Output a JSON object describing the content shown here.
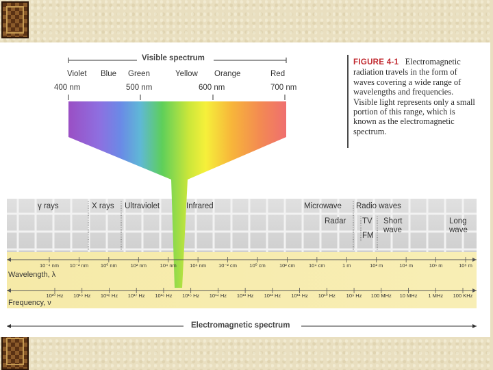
{
  "visible_spectrum": {
    "title": "Visible spectrum",
    "colors": [
      "Violet",
      "Blue",
      "Green",
      "Yellow",
      "Orange",
      "Red"
    ],
    "wavelengths": [
      "400 nm",
      "500 nm",
      "600 nm",
      "700 nm"
    ]
  },
  "caption": {
    "figure_label": "FIGURE 4-1",
    "text": "Electromagnetic radiation travels in the form of waves covering a wide range of wavelengths and frequencies. Visible light represents only a small portion of this range, which is known as the electromagnetic spectrum."
  },
  "regions": [
    "γ rays",
    "X rays",
    "Ultraviolet",
    "Infrared",
    "Microwave",
    "Radio waves"
  ],
  "subregions": [
    "Radar",
    "TV",
    "FM",
    "Short wave",
    "Long wave"
  ],
  "wavelength_axis": {
    "label": "Wavelength, λ",
    "ticks": [
      "10⁻⁴ nm",
      "10⁻² nm",
      "10⁰ nm",
      "10² nm",
      "10⁴ nm",
      "10⁶ nm",
      "10⁻² cm",
      "10⁰ cm",
      "10² cm",
      "10⁴ cm",
      "1 m",
      "10² m",
      "10⁴ m",
      "10⁶ m",
      "10⁸ m"
    ]
  },
  "frequency_axis": {
    "label": "Frequency, ν",
    "ticks": [
      "10²⁰ Hz",
      "10¹⁹ Hz",
      "10¹⁸ Hz",
      "10¹⁷ Hz",
      "10¹⁶ Hz",
      "10¹⁵ Hz",
      "10¹⁴ Hz",
      "10¹³ Hz",
      "10¹² Hz",
      "10¹¹ Hz",
      "10¹⁰ Hz",
      "10⁹ Hz",
      "100 MHz",
      "10 MHz",
      "1 MHz",
      "100 KHz"
    ]
  },
  "footer": {
    "title": "Electromagnetic spectrum"
  },
  "colors": {
    "figure_red": "#c0272d",
    "band_grey": "#d7d7d7",
    "axis_line": "#555555"
  }
}
